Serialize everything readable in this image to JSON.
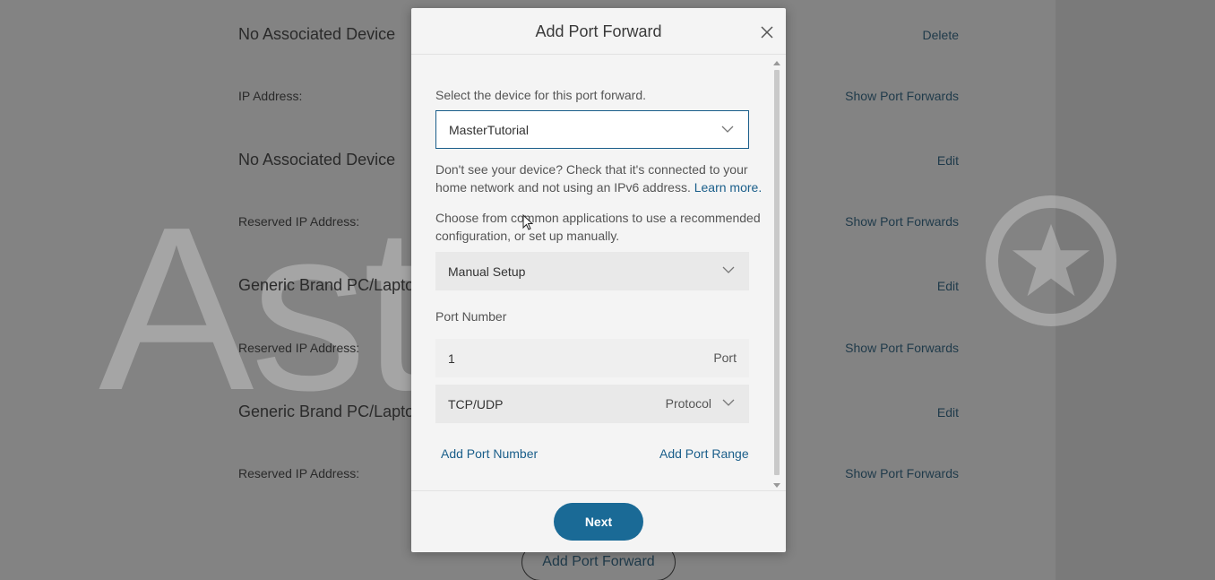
{
  "background": {
    "rows": [
      {
        "name": "No Associated Device",
        "action": "Delete"
      },
      {
        "label": "IP Address:",
        "action": "Show Port Forwards"
      },
      {
        "name": "No Associated Device",
        "action": "Edit"
      },
      {
        "label": "Reserved IP Address:",
        "action": "Show Port Forwards"
      },
      {
        "name": "Generic Brand PC/Laptop",
        "action": "Edit"
      },
      {
        "label": "Reserved IP Address:",
        "action": "Show Port Forwards"
      },
      {
        "name": "Generic Brand PC/Laptop",
        "action": "Edit"
      },
      {
        "label": "Reserved IP Address:",
        "action": "Show Port Forwards"
      }
    ],
    "add_button": "Add Port Forward",
    "watermark": "AstroN"
  },
  "modal": {
    "title": "Add Port Forward",
    "select_device_prompt": "Select the device for this port forward.",
    "device_value": "MasterTutorial",
    "help_text_1": "Don't see your device? Check that it's connected to your",
    "help_text_2": "home network and not using an IPv6 address.",
    "learn_more": "Learn more.",
    "choose_text_1": "Choose from common applications to use a recommended",
    "choose_text_2": "configuration, or set up manually.",
    "application_value": "Manual Setup",
    "port_number_label": "Port Number",
    "port_value": "1",
    "port_suffix": "Port",
    "protocol_value": "TCP/UDP",
    "protocol_label": "Protocol",
    "add_port_number": "Add Port Number",
    "add_port_range": "Add Port Range",
    "next_label": "Next"
  },
  "colors": {
    "accent": "#1a6a96",
    "link": "#1a5e8a"
  }
}
